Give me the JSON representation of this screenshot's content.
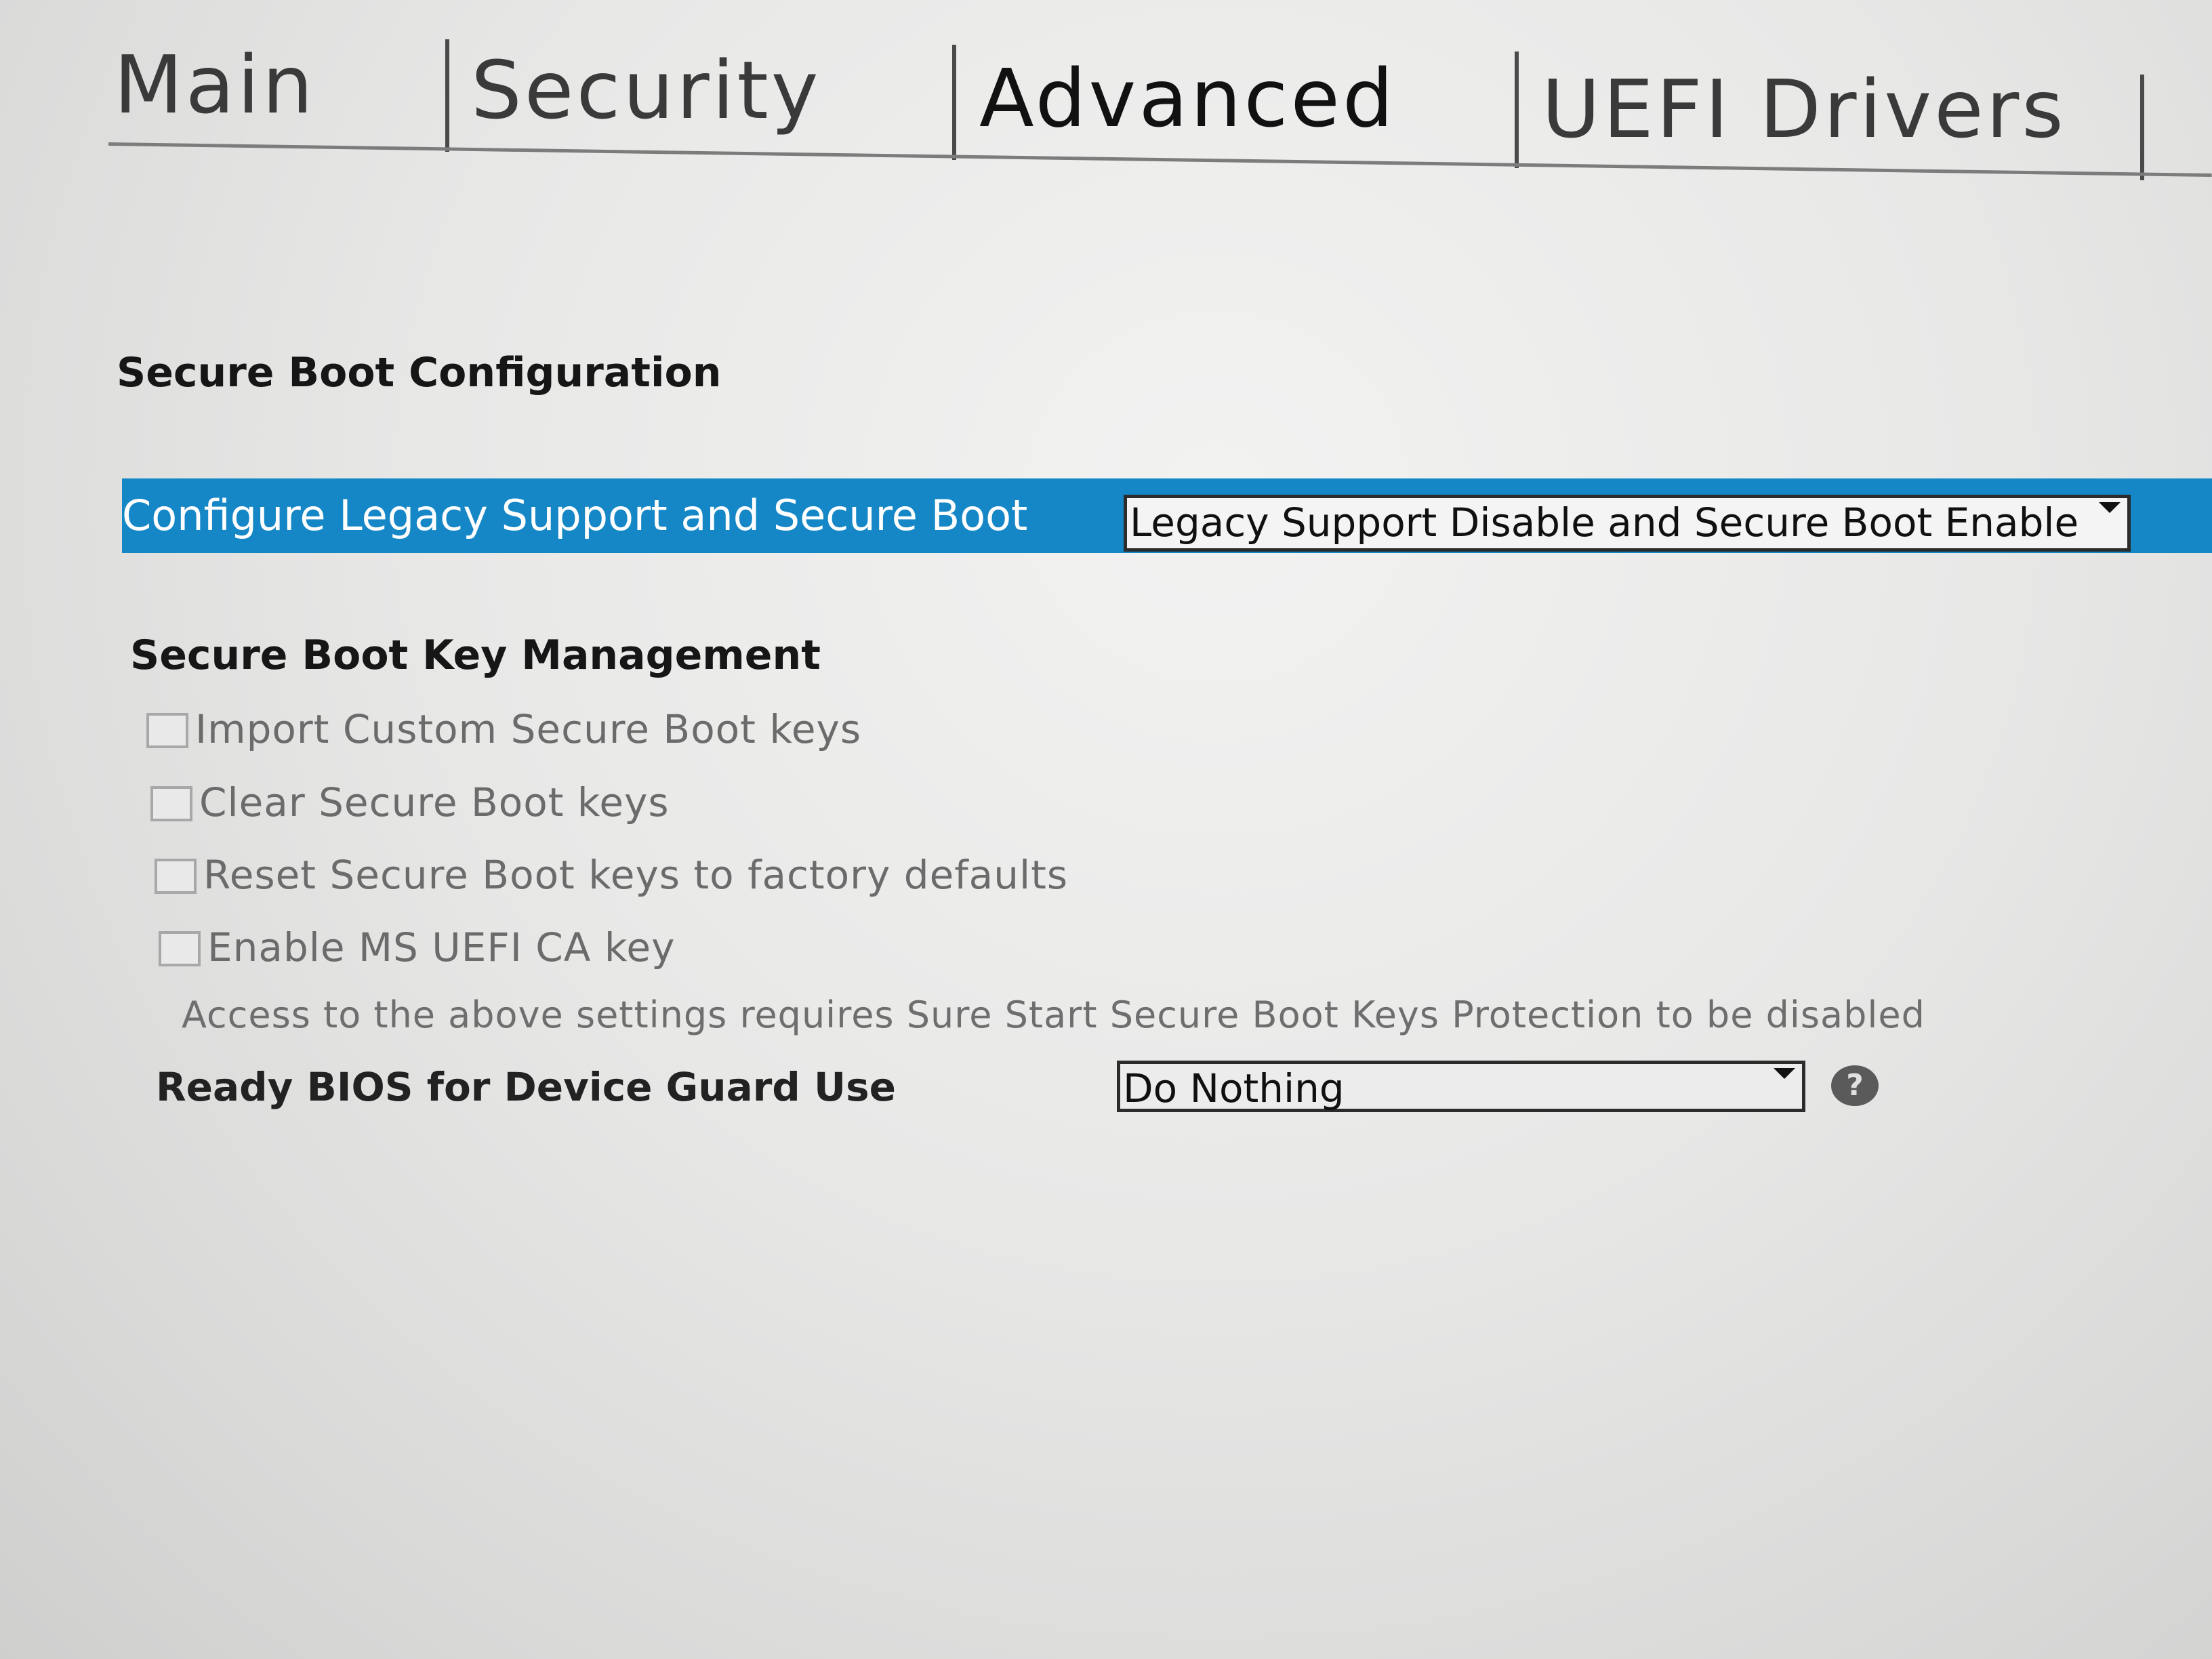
{
  "tabs": [
    {
      "label": "Main"
    },
    {
      "label": "Security"
    },
    {
      "label": "Advanced"
    },
    {
      "label": "UEFI Drivers"
    }
  ],
  "active_tab": "Advanced",
  "secure_boot_configuration": {
    "title": "Secure Boot Configuration",
    "configure_label": "Configure Legacy Support and Secure Boot",
    "configure_value": "Legacy Support Disable and Secure Boot Enable"
  },
  "key_management": {
    "title": "Secure Boot Key Management",
    "options": [
      {
        "label": "Import Custom Secure Boot keys",
        "checked": false,
        "enabled": false
      },
      {
        "label": "Clear Secure Boot keys",
        "checked": false,
        "enabled": false
      },
      {
        "label": "Reset Secure Boot keys to factory defaults",
        "checked": false,
        "enabled": false
      },
      {
        "label": "Enable MS UEFI CA key",
        "checked": false,
        "enabled": false
      }
    ],
    "note": "Access to the above settings requires Sure Start Secure Boot Keys Protection to be disabled"
  },
  "device_guard": {
    "label": "Ready BIOS for Device Guard Use",
    "value": "Do Nothing",
    "help_icon": "help-circle-icon",
    "help_glyph": "?"
  },
  "colors": {
    "highlight": "#1587c6",
    "background": "#e8e8e7"
  }
}
